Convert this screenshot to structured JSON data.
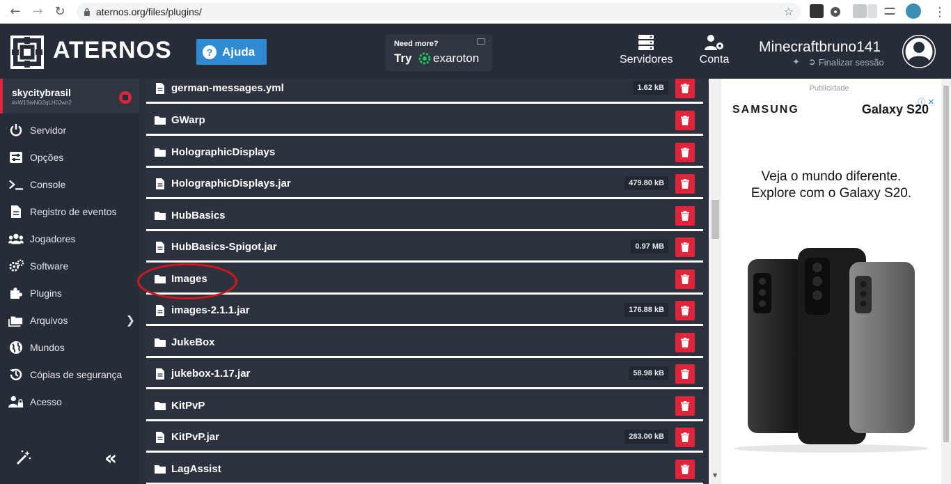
{
  "browser": {
    "url": "aternos.org/files/plugins/"
  },
  "header": {
    "brand": "ATERNOS",
    "help_label": "Ajuda",
    "exaroton": {
      "need_more": "Need more?",
      "try": "Try",
      "name": "exaroton"
    },
    "servers_label": "Servidores",
    "account_label": "Conta",
    "username": "Minecraftbruno141",
    "logout_label": "Finalizar sessão"
  },
  "server": {
    "name": "skycitybrasil",
    "id": "#xW1SwNG2qLH0Jwn2"
  },
  "sidebar": {
    "items": [
      {
        "label": "Servidor",
        "icon": "power-icon"
      },
      {
        "label": "Opções",
        "icon": "sliders-icon"
      },
      {
        "label": "Console",
        "icon": "terminal-icon"
      },
      {
        "label": "Registro de eventos",
        "icon": "file-icon"
      },
      {
        "label": "Jogadores",
        "icon": "users-icon"
      },
      {
        "label": "Software",
        "icon": "gears-icon"
      },
      {
        "label": "Plugins",
        "icon": "puzzle-icon"
      },
      {
        "label": "Arquivos",
        "icon": "folders-icon"
      },
      {
        "label": "Mundos",
        "icon": "globe-icon"
      },
      {
        "label": "Cópias de segurança",
        "icon": "history-icon"
      },
      {
        "label": "Acesso",
        "icon": "user-lock-icon"
      }
    ]
  },
  "files": [
    {
      "name": "german-messages.yml",
      "type": "file",
      "size": "1.62 kB"
    },
    {
      "name": "GWarp",
      "type": "folder",
      "size": ""
    },
    {
      "name": "HolographicDisplays",
      "type": "folder",
      "size": ""
    },
    {
      "name": "HolographicDisplays.jar",
      "type": "file",
      "size": "479.80 kB"
    },
    {
      "name": "HubBasics",
      "type": "folder",
      "size": ""
    },
    {
      "name": "HubBasics-Spigot.jar",
      "type": "file",
      "size": "0.97 MB"
    },
    {
      "name": "Images",
      "type": "folder",
      "size": ""
    },
    {
      "name": "images-2.1.1.jar",
      "type": "file",
      "size": "176.88 kB"
    },
    {
      "name": "JukeBox",
      "type": "folder",
      "size": ""
    },
    {
      "name": "jukebox-1.17.jar",
      "type": "file",
      "size": "58.98 kB"
    },
    {
      "name": "KitPvP",
      "type": "folder",
      "size": ""
    },
    {
      "name": "KitPvP.jar",
      "type": "file",
      "size": "283.00 kB"
    },
    {
      "name": "LagAssist",
      "type": "folder",
      "size": ""
    }
  ],
  "ad": {
    "label": "Publicidade",
    "brand": "SAMSUNG",
    "product": "Galaxy S20",
    "line1": "Veja o mundo diferente.",
    "line2": "Explore com o Galaxy S20."
  },
  "colors": {
    "accent_red": "#e0243a",
    "accent_blue": "#2e8bd3",
    "background": "#262d38",
    "row": "#2c333e"
  }
}
